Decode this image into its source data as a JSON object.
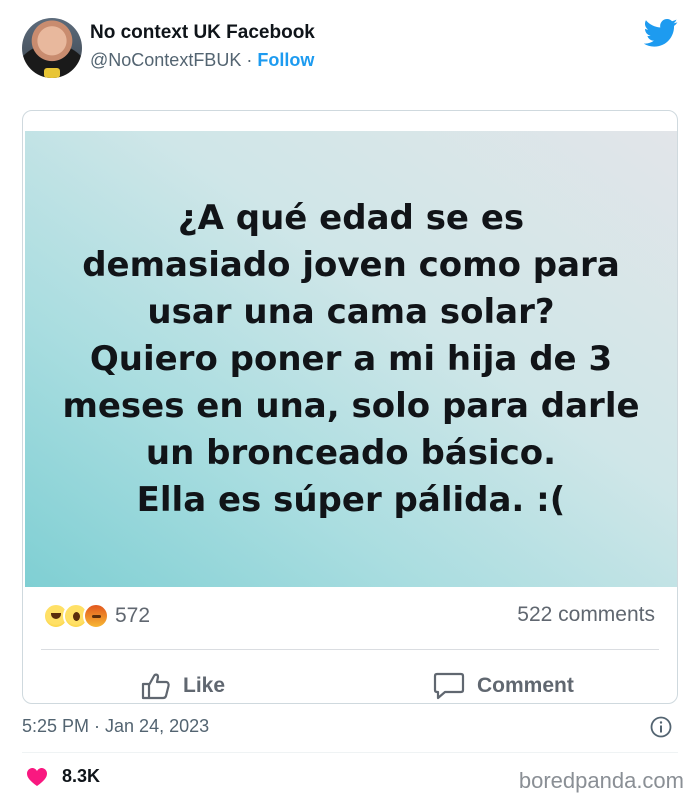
{
  "tweet": {
    "account_name": "No context UK Facebook",
    "handle": "@NoContextFBUK",
    "separator": "·",
    "follow_label": "Follow",
    "timestamp": "5:25 PM · Jan 24, 2023",
    "likes": "8.3K"
  },
  "facebook_post": {
    "lines": [
      "¿A qué edad se es",
      "demasiado joven como para",
      "usar una cama solar?",
      "Quiero poner a mi hija de 3",
      "meses en una, solo para darle",
      "un bronceado básico.",
      "Ella es súper pálida. :("
    ],
    "reaction_icons": [
      "haha-emoji",
      "wow-emoji",
      "angry-emoji"
    ],
    "reaction_count": "572",
    "comments": "522 comments",
    "like_label": "Like",
    "comment_label": "Comment"
  },
  "watermark": "boredpanda.com",
  "colors": {
    "accent": "#1d9bf0",
    "heart": "#f91880",
    "post_background_start": "#7fcfd3",
    "post_background_end": "#e2e5e9"
  }
}
